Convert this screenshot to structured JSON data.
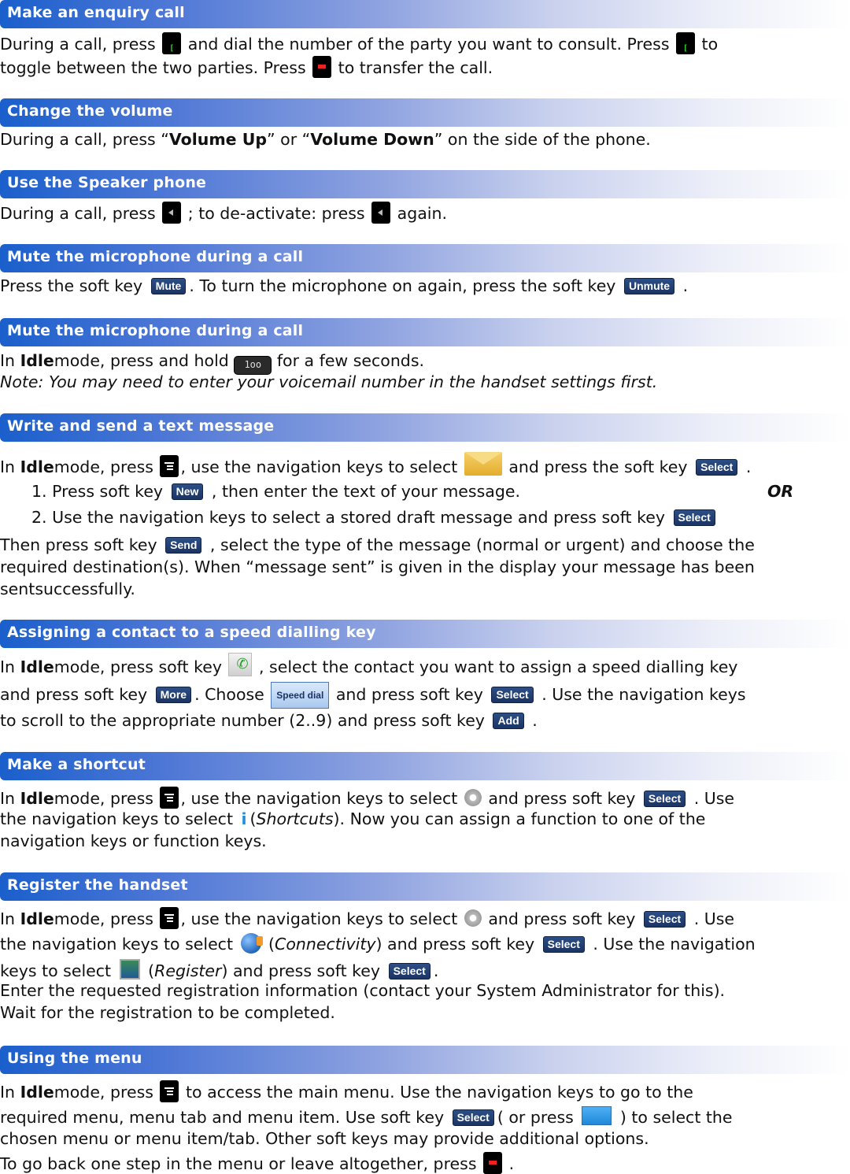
{
  "sections": [
    {
      "title": "Make an enquiry call",
      "lines": [
        {
          "t1": "During a call, press ",
          "t2": " and dial the number of the party you want to consult. Press ",
          "t3": " to"
        },
        {
          "t1": "toggle between the two parties. Press ",
          "t2": " to transfer the call."
        }
      ]
    },
    {
      "title": "Change the volume",
      "lines": [
        {
          "t1": "During a call, press “",
          "b1": "Volume Up",
          "t2": "” or “",
          "b2": "Volume Down",
          "t3": "” on the side of the phone."
        }
      ]
    },
    {
      "title": "Use the Speaker phone",
      "lines": [
        {
          "t1": "During a call, press ",
          "t2": " ; to de-activate: press ",
          "t3": " again."
        }
      ]
    },
    {
      "title": "Mute the microphone during a call",
      "lines": [
        {
          "t1": "Press the soft key ",
          "t2": ". To turn the microphone on again, press the soft key ",
          "t3": " ."
        }
      ]
    },
    {
      "title": "Mute the microphone during a call",
      "lines": [
        {
          "t1": "In ",
          "b1": "Idle",
          "t2": "mode, press and hold ",
          "t3": " for a few seconds."
        },
        {
          "i1": "Note: You may need to enter your voicemail number in the handset settings first."
        }
      ]
    },
    {
      "title": "Write and send a text message",
      "lines": [
        {
          "t1": "In ",
          "b1": "Idle",
          "t2": "mode, press ",
          "t3": ", use the navigation keys to select ",
          "t4": " and press the soft key ",
          "t5": " ."
        },
        {
          "t1": "1.  Press soft key ",
          "t2": " , then enter the text of your message.",
          "b1": "OR"
        },
        {
          "t1": "2.  Use the navigation keys to select a stored draft message and press soft key "
        },
        {
          "t1": "Then press soft key ",
          "t2": " , select the type of the message (normal or urgent) and choose the"
        },
        {
          "t1": "required destination(s).  When “message sent” is given in the display your message has been"
        },
        {
          "t1": "sentsuccessfully."
        }
      ]
    },
    {
      "title": "Assigning a contact to a speed dialling key",
      "lines": [
        {
          "t1": "In ",
          "b1": "Idle",
          "t2": "mode, press soft key ",
          "t3": " , select the contact you want to assign a speed dialling key"
        },
        {
          "t1": "and press soft key ",
          "t2": ". Choose ",
          "t3": " and press soft key ",
          "t4": " . Use the navigation keys"
        },
        {
          "t1": "to scroll to the appropriate number (2..9) and press soft key ",
          "t2": " ."
        }
      ]
    },
    {
      "title": "Make a shortcut",
      "lines": [
        {
          "t1": "In ",
          "b1": "Idle",
          "t2": "mode, press ",
          "t3": ", use the navigation keys to select ",
          "t4": " and press soft key ",
          "t5": " .  Use"
        },
        {
          "t1": "the navigation keys to select ",
          "t2": "(",
          "i1": "Shortcuts",
          "t3": "). Now you can assign a function to one of the"
        },
        {
          "t1": "navigation keys or function keys."
        }
      ]
    },
    {
      "title": "Register the handset",
      "lines": [
        {
          "t1": "In ",
          "b1": "Idle",
          "t2": "mode, press ",
          "t3": ", use the navigation keys to select ",
          "t4": " and press soft key ",
          "t5": " .  Use"
        },
        {
          "t1": "the navigation keys to select ",
          "t2": " (",
          "i1": "Connectivity",
          "t3": ") and press soft key ",
          "t4": " . Use the navigation"
        },
        {
          "t1": "keys to select ",
          "t2": " (",
          "i1": "Register",
          "t3": ") and press soft key ",
          "t4": "."
        },
        {
          "t1": "Enter the requested registration information (contact your System Administrator for this)."
        },
        {
          "t1": "Wait for the registration to be completed."
        }
      ]
    },
    {
      "title": "Using the menu",
      "lines": [
        {
          "t1": "In ",
          "b1": "Idle",
          "t2": "mode, press ",
          "t3": " to access the main menu. Use the navigation keys to go to the"
        },
        {
          "t1": "required menu, menu tab and menu item. Use soft key ",
          "t2": "( or press ",
          "t3": " ) to select the"
        },
        {
          "t1": "chosen menu or menu item/tab. Other soft keys may provide additional options."
        },
        {
          "t1": "To go back one step in the menu or leave altogether, press ",
          "t2": " ."
        }
      ]
    }
  ],
  "softkeys": {
    "mute": "Mute",
    "unmute": "Unmute",
    "select": "Select",
    "new": "New",
    "send": "Send",
    "more": "More",
    "speed_dial": "Speed dial",
    "add": "Add"
  },
  "voicemail_key_label": "1oo",
  "icons": {
    "call_key": "green-call-key-icon",
    "end_key": "red-end-key-icon",
    "speaker_key": "speaker-key-icon",
    "menu_key": "menu-key-icon",
    "message": "envelope-icon",
    "settings": "gear-icon",
    "shortcuts": "info-icon",
    "connectivity": "globe-icon",
    "register": "register-icon",
    "contacts": "phonebook-icon",
    "ok_key": "blue-ok-key-icon"
  },
  "colors": {
    "header_start": "#1a5fcc",
    "softkey_bg": "#1b3463",
    "call_green": "#2bdc2b",
    "end_red": "#e22222"
  }
}
